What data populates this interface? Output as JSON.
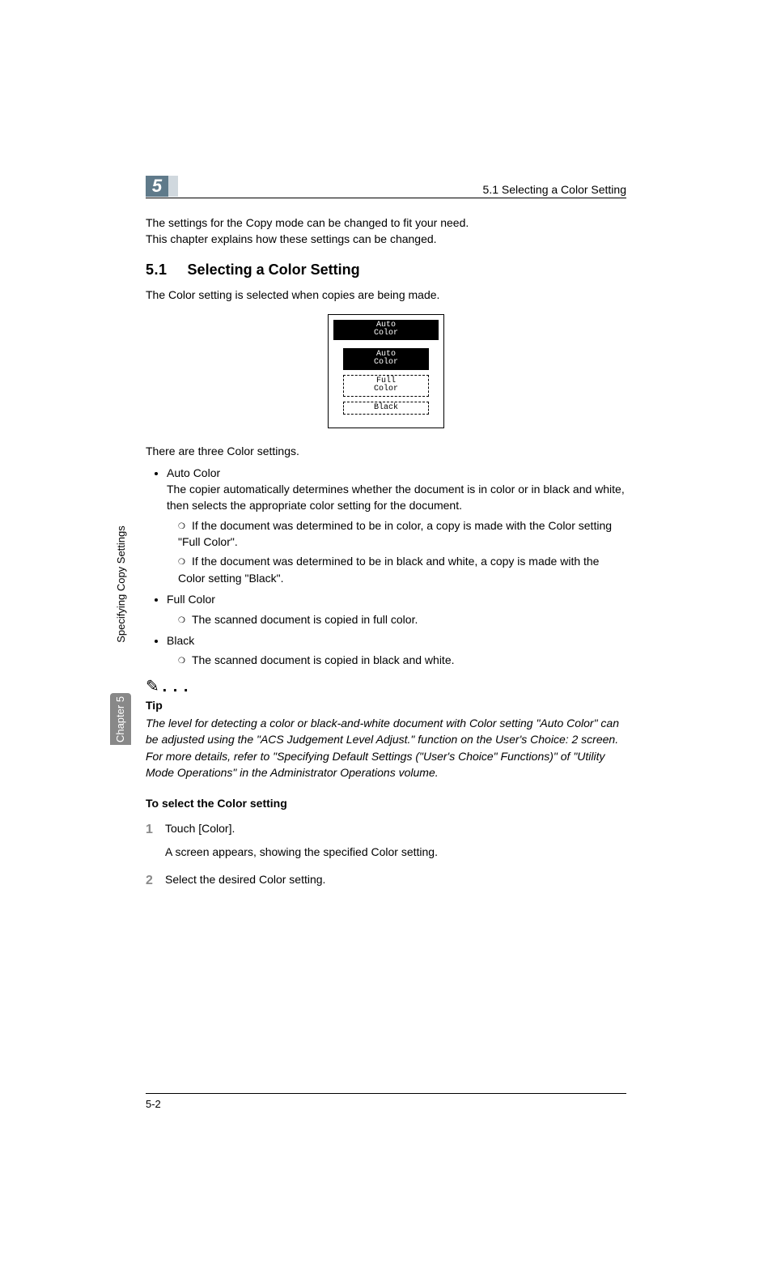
{
  "header": {
    "chapter_num": "5",
    "section_ref": "5.1 Selecting a Color Setting"
  },
  "side": {
    "chapter_label": "Chapter 5",
    "title": "Specifying Copy Settings"
  },
  "intro": {
    "line1": "The settings for the Copy mode can be changed to fit your need.",
    "line2": "This chapter explains how these settings can be changed."
  },
  "section": {
    "num": "5.1",
    "title": "Selecting a Color Setting",
    "lead": "The Color setting is selected when copies are being made."
  },
  "figure": {
    "title_l1": "Auto",
    "title_l2": "Color",
    "opt1_l1": "Auto",
    "opt1_l2": "Color",
    "opt2_l1": "Full",
    "opt2_l2": "Color",
    "opt3": "Black"
  },
  "body": {
    "three_settings": "There are three Color settings.",
    "auto_title": "Auto Color",
    "auto_desc": "The copier automatically determines whether the document is in color or in black and white, then selects the appropriate color setting for the document.",
    "auto_s1": "If the document was determined to be in color, a copy is made with the Color setting \"Full Color\".",
    "auto_s2": "If the document was determined to be in black and white, a copy is made with the Color setting \"Black\".",
    "full_title": "Full Color",
    "full_s1": "The scanned document is copied in full color.",
    "black_title": "Black",
    "black_s1": "The scanned document is copied in black and white."
  },
  "tip": {
    "icon": "✎",
    "dots": ". . .",
    "label": "Tip",
    "text": "The level for detecting a color or black-and-white document with Color setting \"Auto Color\" can be adjusted using the \"ACS Judgement Level Adjust.\" function on the User's Choice: 2 screen. For more details, refer to \"Specifying Default Settings (\"User's Choice\" Functions)\" of \"Utility Mode Operations\" in the Administrator Operations volume."
  },
  "procedure": {
    "title": "To select the Color setting",
    "step1_num": "1",
    "step1": "Touch [Color].",
    "step1_follow": "A screen appears, showing the specified Color setting.",
    "step2_num": "2",
    "step2": "Select the desired Color setting."
  },
  "footer": {
    "page": "5-2"
  }
}
